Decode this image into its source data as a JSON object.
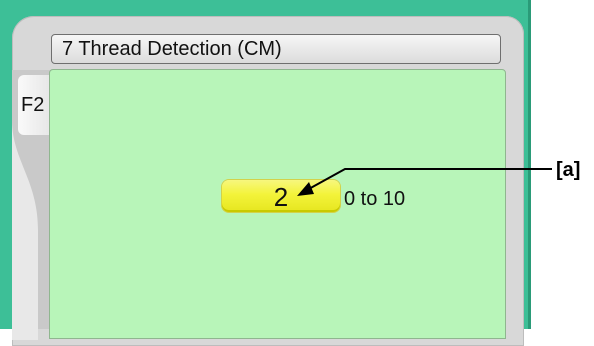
{
  "window": {
    "title": "7 Thread Detection (CM)"
  },
  "side_tabs": [
    {
      "label": "F2"
    }
  ],
  "setting": {
    "value": "2",
    "range": "0 to 10"
  },
  "annotation": {
    "label": "[a]"
  },
  "colors": {
    "frame": "#3dbf97",
    "content_bg": "#b8f5b9",
    "value_box": "#f3f33a"
  }
}
